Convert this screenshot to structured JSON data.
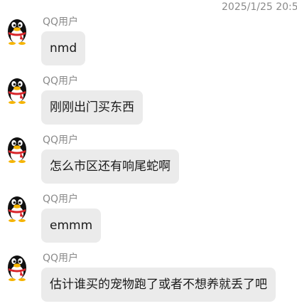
{
  "header": {
    "timestamp": "2025/1/25 20:5"
  },
  "messages": [
    {
      "sender": "QQ用户",
      "text": "nmd",
      "avatar_icon": "qq-penguin-icon"
    },
    {
      "sender": "QQ用户",
      "text": "刚刚出门买东西",
      "avatar_icon": "qq-penguin-icon"
    },
    {
      "sender": "QQ用户",
      "text": "怎么市区还有响尾蛇啊",
      "avatar_icon": "qq-penguin-icon"
    },
    {
      "sender": "QQ用户",
      "text": "emmm",
      "avatar_icon": "qq-penguin-icon"
    },
    {
      "sender": "QQ用户",
      "text": "估计谁买的宠物跑了或者不想养就丢了吧",
      "avatar_icon": "qq-penguin-icon"
    }
  ],
  "colors": {
    "bubble_bg": "#ebebeb",
    "meta_text": "#8a8a8a",
    "message_text": "#1a1a1a",
    "penguin_scarf": "#d8252a",
    "penguin_beak": "#f5b400"
  }
}
